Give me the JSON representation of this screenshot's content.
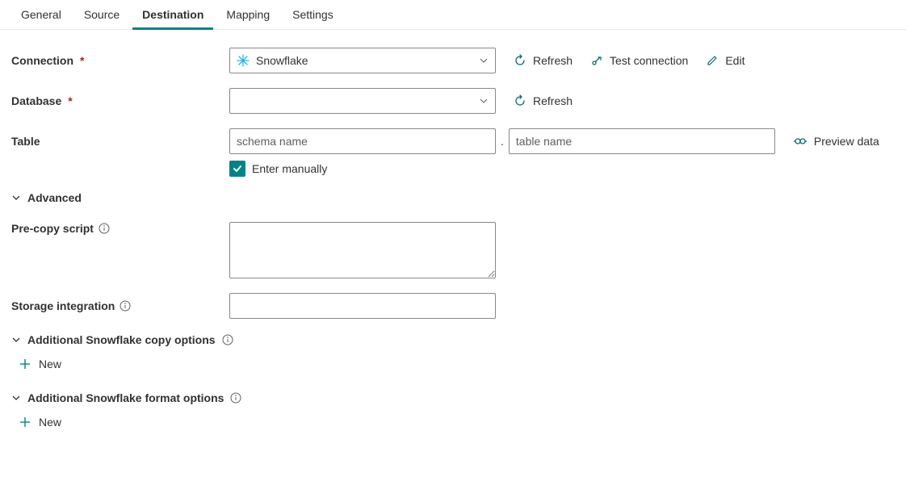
{
  "tabs": {
    "general": "General",
    "source": "Source",
    "destination": "Destination",
    "mapping": "Mapping",
    "settings": "Settings"
  },
  "labels": {
    "connection": "Connection",
    "database": "Database",
    "table": "Table",
    "advanced": "Advanced",
    "precopy": "Pre-copy script",
    "storage": "Storage integration",
    "copy_options": "Additional Snowflake copy options",
    "format_options": "Additional Snowflake format options"
  },
  "connection": {
    "value": "Snowflake"
  },
  "database": {
    "value": ""
  },
  "table": {
    "schema_placeholder": "schema name",
    "table_placeholder": "table name",
    "enter_manually_label": "Enter manually",
    "enter_manually_checked": true
  },
  "actions": {
    "refresh": "Refresh",
    "test_connection": "Test connection",
    "edit": "Edit",
    "preview_data": "Preview data",
    "new": "New"
  },
  "precopy": {
    "value": ""
  },
  "storage": {
    "value": ""
  }
}
